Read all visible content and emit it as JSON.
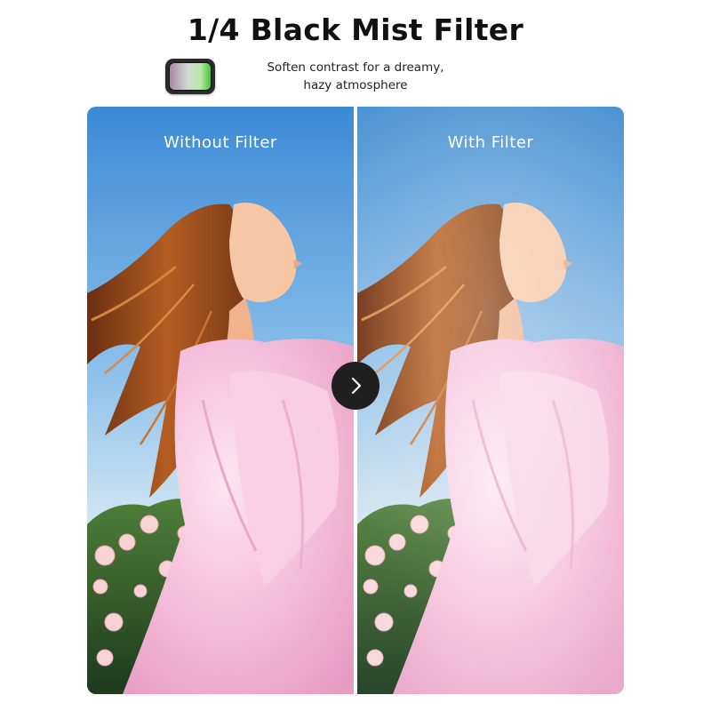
{
  "header": {
    "title": "1/4 Black Mist Filter",
    "subtitle_line1": "Soften contrast for a dreamy,",
    "subtitle_line2": "hazy atmosphere",
    "icon": "filter-lens-icon"
  },
  "comparison": {
    "left_label": "Without Filter",
    "right_label": "With  Filter",
    "divider_icon": "chevron-right-icon"
  },
  "colors": {
    "title_text": "#111111",
    "sky_top": "#3f8fd8",
    "dress": "#f2b9d6",
    "hair": "#9a4c1c",
    "divider_button": "#1f1f1f"
  }
}
